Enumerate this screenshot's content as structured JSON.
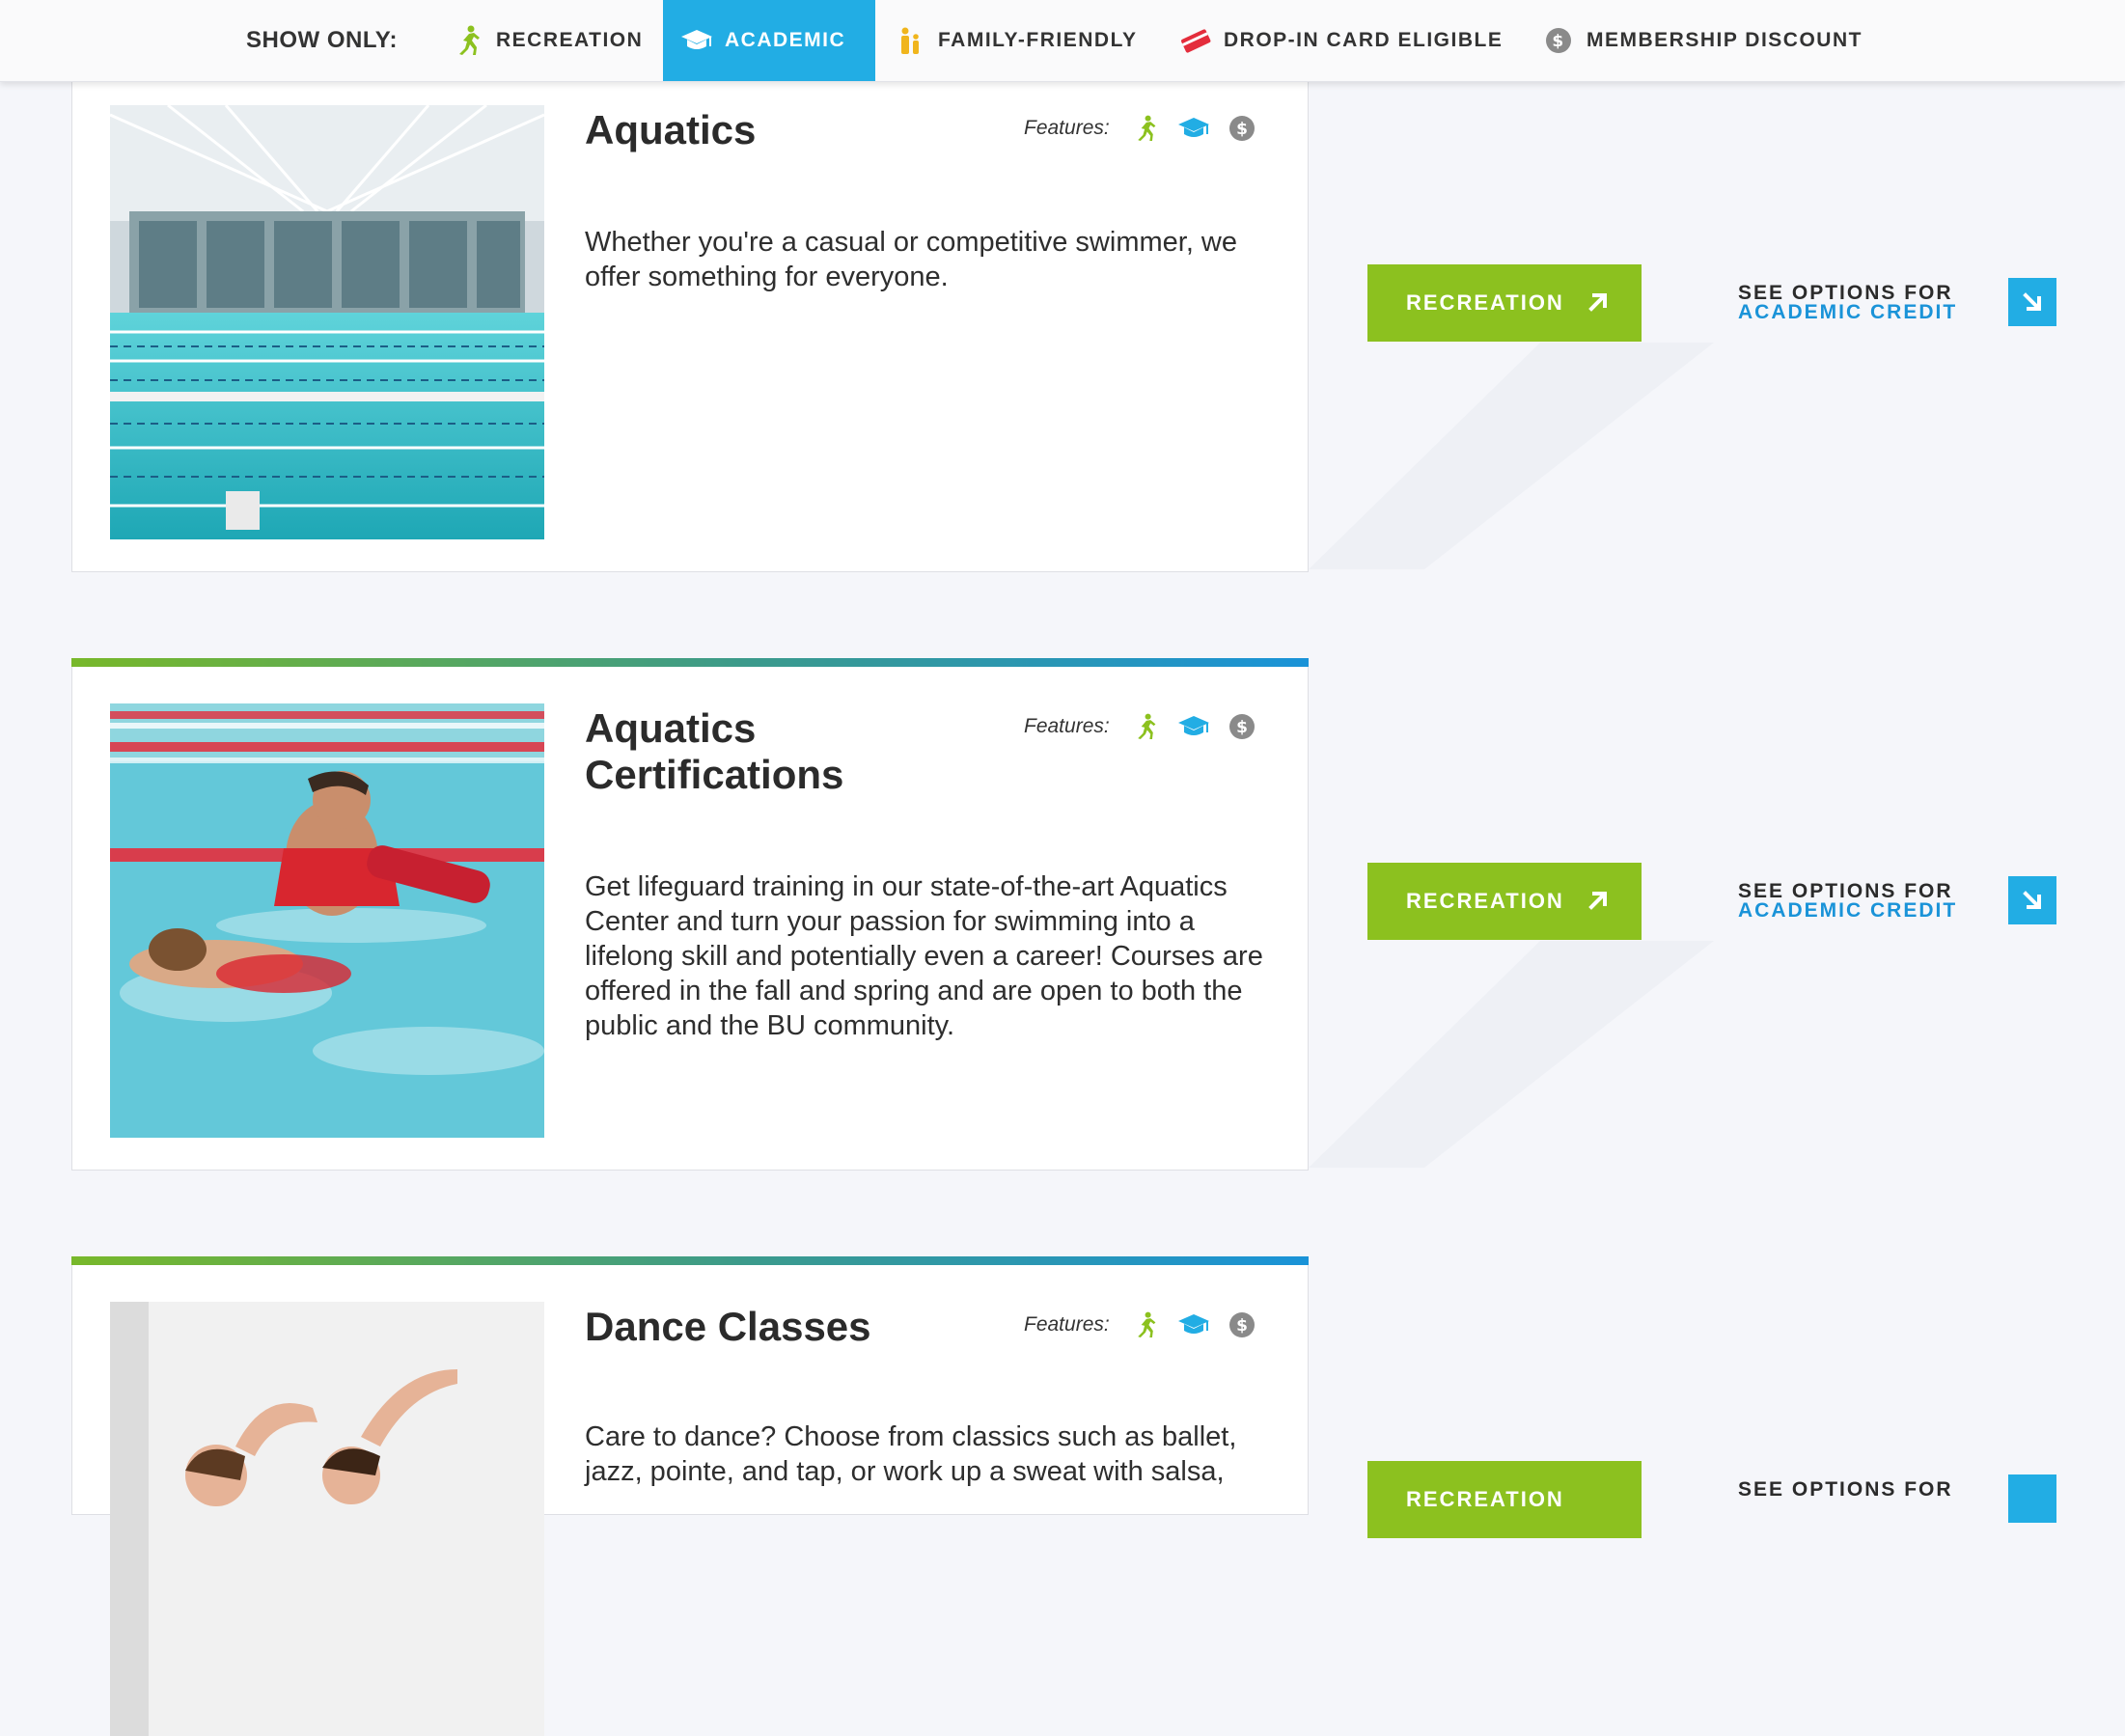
{
  "filter_bar": {
    "label": "SHOW ONLY:",
    "filters": [
      {
        "label": "RECREATION",
        "icon": "running-person-icon",
        "color": "#8cc11f",
        "active": false
      },
      {
        "label": "ACADEMIC",
        "icon": "graduation-cap-icon",
        "color": "#22ade4",
        "active": true
      },
      {
        "label": "FAMILY-FRIENDLY",
        "icon": "family-icon",
        "color": "#f0b51c",
        "active": false
      },
      {
        "label": "DROP-IN CARD ELIGIBLE",
        "icon": "card-icon",
        "color": "#e42d3c",
        "active": false
      },
      {
        "label": "MEMBERSHIP DISCOUNT",
        "icon": "dollar-icon",
        "color": "#8a8a8a",
        "active": false
      }
    ]
  },
  "features_label": "Features:",
  "cta": {
    "recreation_label": "RECREATION",
    "see_options_line1": "SEE OPTIONS FOR",
    "see_options_line2": "ACADEMIC CREDIT"
  },
  "programs": [
    {
      "title": "Aquatics",
      "description": "Whether you're a casual or competitive swimmer, we offer something for everyone.",
      "image": "indoor-pool-photo"
    },
    {
      "title": "Aquatics Certifications",
      "description": "Get lifeguard training in our state-of-the-art Aquatics Center and turn your passion for swimming into a lifelong skill and potentially even a career! Courses are offered in the fall and spring and are open to both the public and the BU community.",
      "image": "lifeguard-training-photo"
    },
    {
      "title": "Dance Classes",
      "description": "Care to dance? Choose from classics such as ballet, jazz, pointe, and tap, or work up a sweat with salsa,",
      "image": "dance-class-photo"
    }
  ],
  "colors": {
    "recreation_green": "#8cc11f",
    "academic_blue": "#22ade4",
    "page_background": "#f5f6fa"
  }
}
